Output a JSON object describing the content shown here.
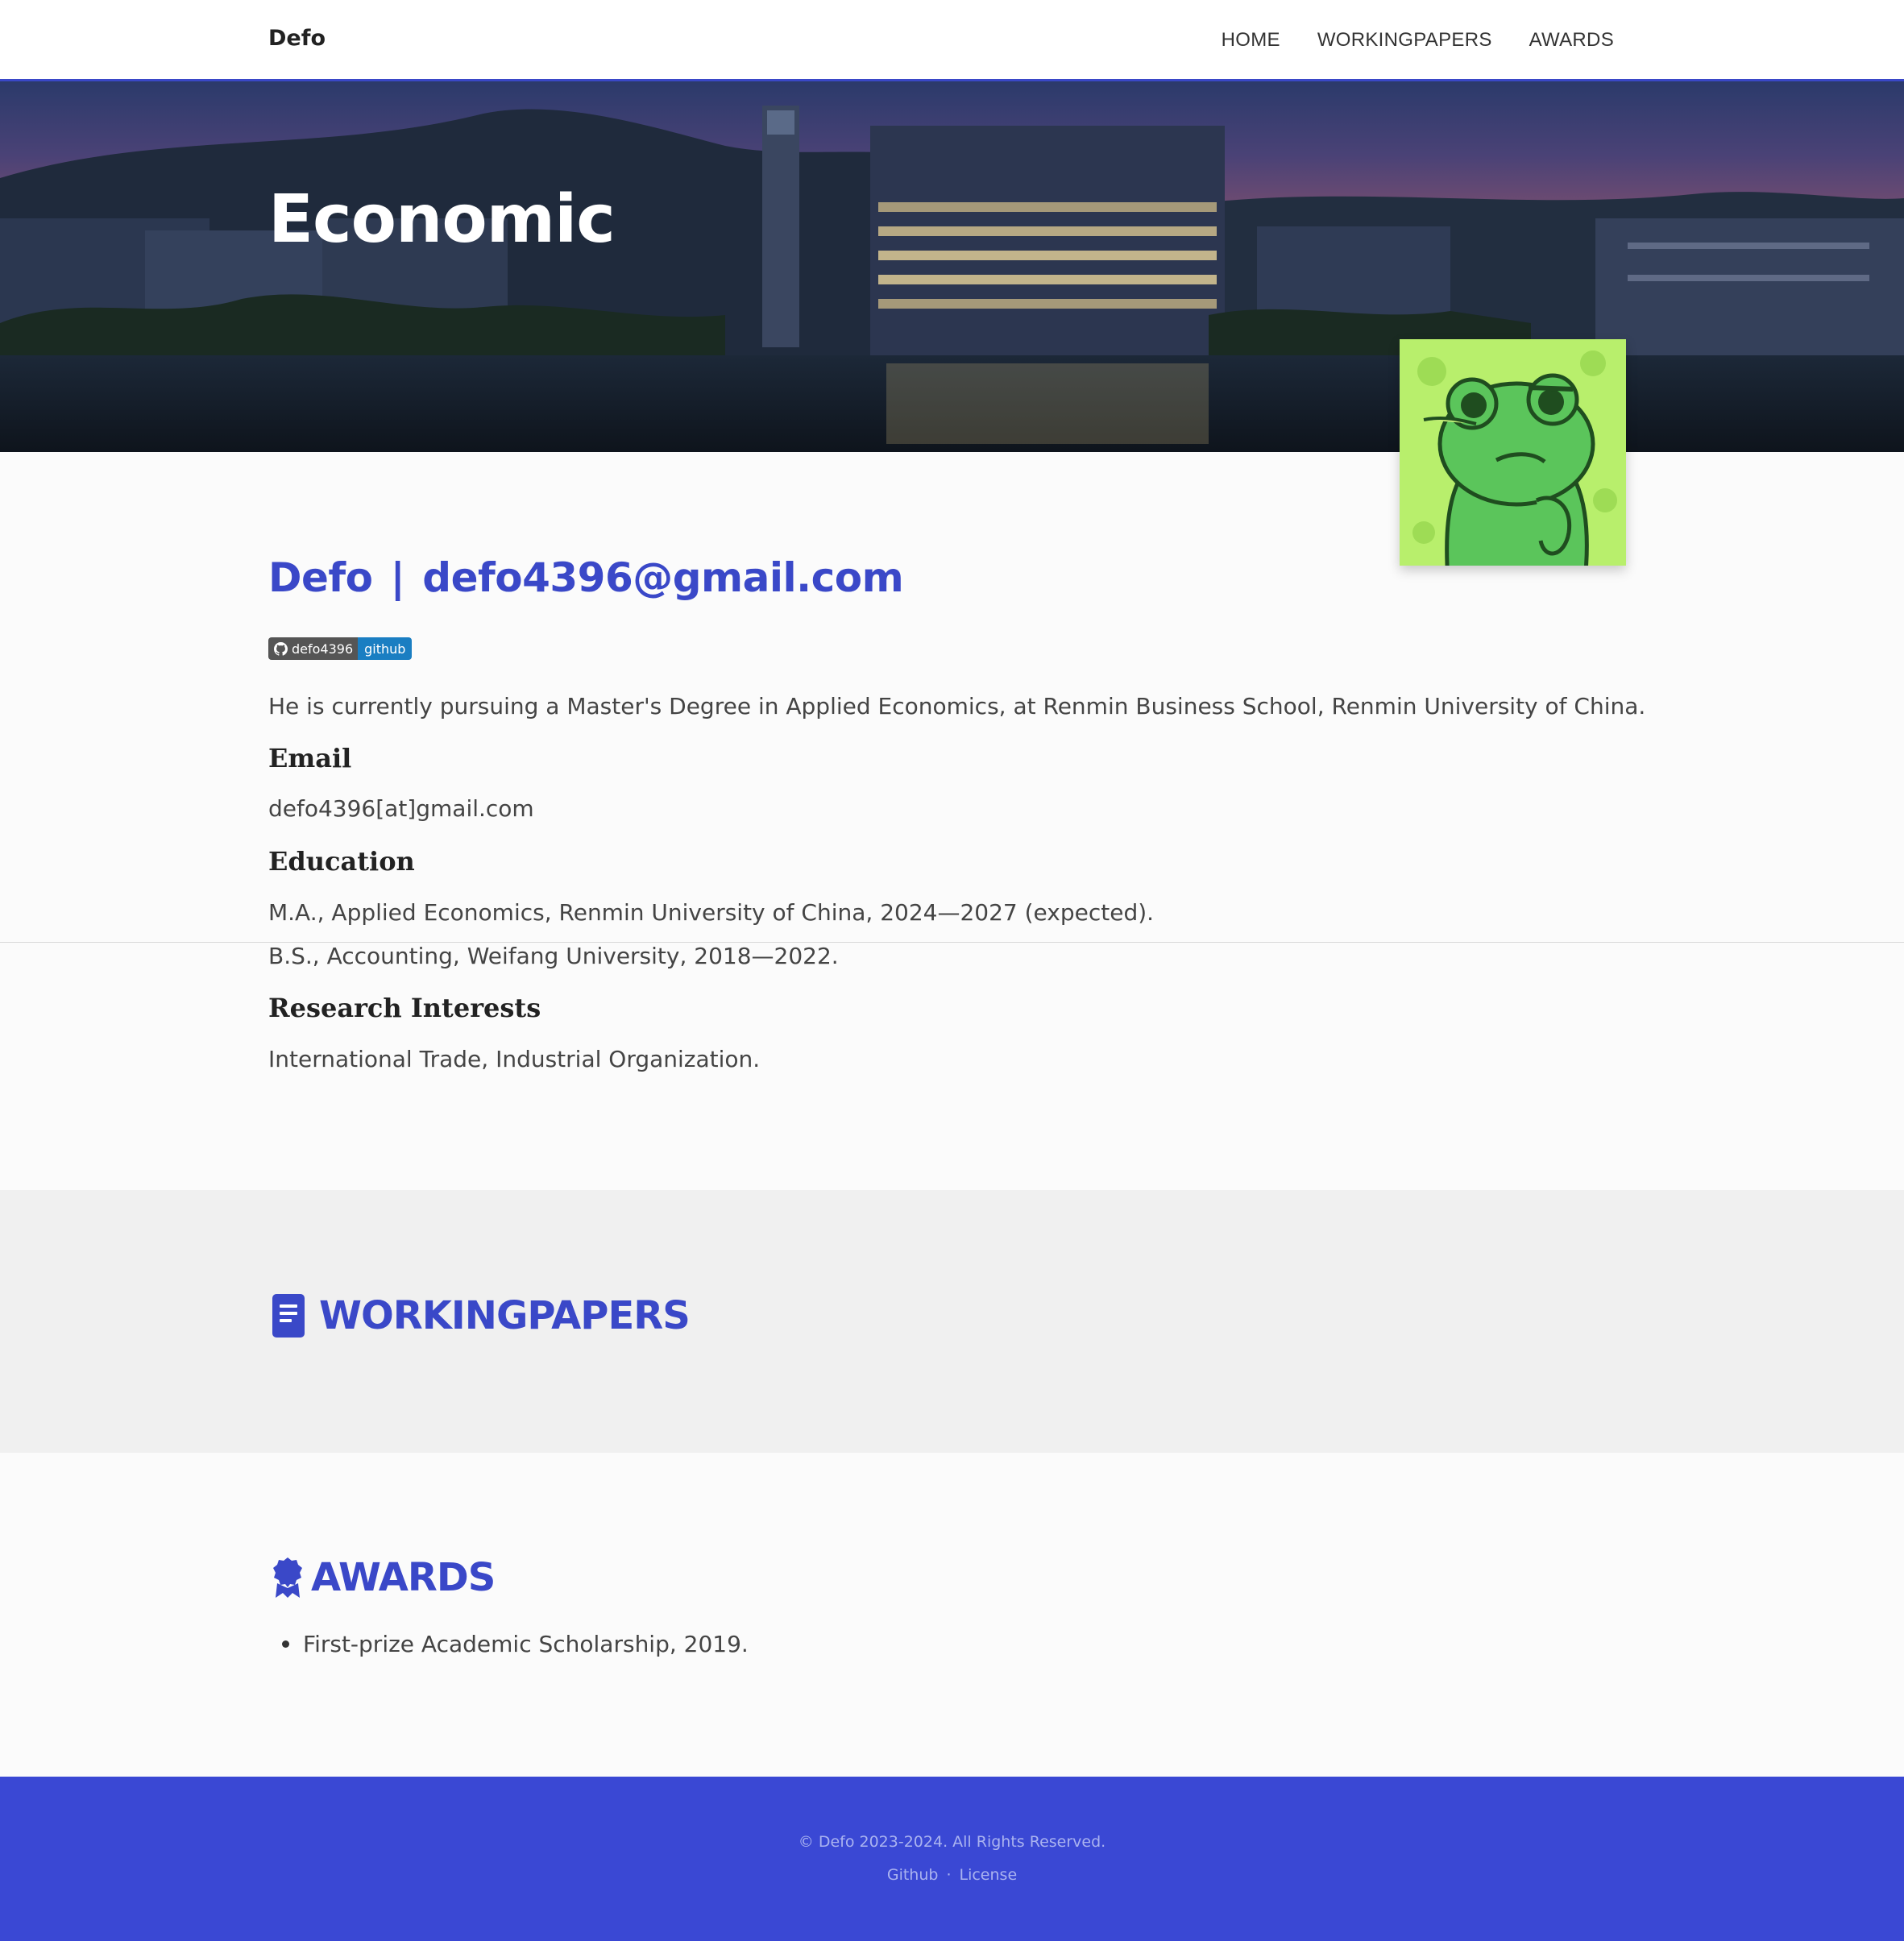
{
  "navbar": {
    "brand": "Defo",
    "links": [
      "HOME",
      "WORKINGPAPERS",
      "AWARDS"
    ]
  },
  "hero": {
    "title": "Economic"
  },
  "profile": {
    "name": "Defo",
    "separator": "|",
    "email_heading": "defo4396@gmail.com",
    "badge": {
      "label": "defo4396",
      "value": "github",
      "icon": "github-icon"
    },
    "intro": "He is currently pursuing a Master's Degree in Applied Economics, at Renmin Business School, Renmin University of China.",
    "email_title": "Email",
    "email_text": "defo4396[at]gmail.com",
    "education_title": "Education",
    "education": [
      "M.A., Applied Economics, Renmin University of China, 2024—2027 (expected).",
      "B.S., Accounting, Weifang University, 2018—2022."
    ],
    "research_title": "Research Interests",
    "research_text": "International Trade, Industrial Organization."
  },
  "workingpapers": {
    "title": "WORKINGPAPERS",
    "icon": "document-icon"
  },
  "awards": {
    "title": "AWARDS",
    "icon": "award-ribbon-icon",
    "items": [
      "First-prize Academic Scholarship, 2019."
    ]
  },
  "footer": {
    "copyright": "© Defo 2023-2024. All Rights Reserved.",
    "links": [
      "Github",
      "License"
    ],
    "separator": "·"
  },
  "colors": {
    "accent": "#3a48c8",
    "footer_bg": "#3a48d4",
    "badge_left": "#555555",
    "badge_right": "#1a7ec2"
  }
}
